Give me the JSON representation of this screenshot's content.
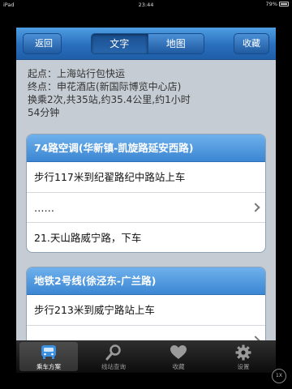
{
  "ipad_status": {
    "carrier": "iPad",
    "time": "23:44",
    "battery": "79%"
  },
  "nav": {
    "back_label": "返回",
    "segments": [
      {
        "label": "文字",
        "active": true
      },
      {
        "label": "地图",
        "active": false
      }
    ],
    "fav_label": "收藏"
  },
  "summary": {
    "start": "起点：上海站行包快运",
    "end": "终点：申花酒店(新国际博览中心店)",
    "info_line1": "换乘2次,共35站,约35.4公里,约1小时",
    "info_line2": "54分钟"
  },
  "routes": [
    {
      "title": "74路空调(华新镇-凯旋路延安西路)",
      "rows": [
        {
          "text": "步行117米到纪翟路纪中路站上车",
          "chevron": false
        },
        {
          "text": "……",
          "chevron": true
        },
        {
          "text": "21.天山路威宁路，下车",
          "chevron": false
        }
      ]
    },
    {
      "title": "地铁2号线(徐泾东-广兰路)",
      "rows": [
        {
          "text": "步行213米到威宁路站上车",
          "chevron": false
        },
        {
          "text": "",
          "chevron": true
        }
      ]
    }
  ],
  "tabbar": {
    "items": [
      {
        "label": "乘车方案",
        "icon": "bus-icon",
        "active": true
      },
      {
        "label": "线站查询",
        "icon": "magnifier-icon",
        "active": false
      },
      {
        "label": "收藏",
        "icon": "heart-icon",
        "active": false
      },
      {
        "label": "设置",
        "icon": "gear-icon",
        "active": false
      }
    ]
  },
  "zoom_label": "1X",
  "colors": {
    "nav_blue": "#2a6fbd",
    "card_header_blue": "#4a93dc",
    "background": "#c5ccd4"
  }
}
